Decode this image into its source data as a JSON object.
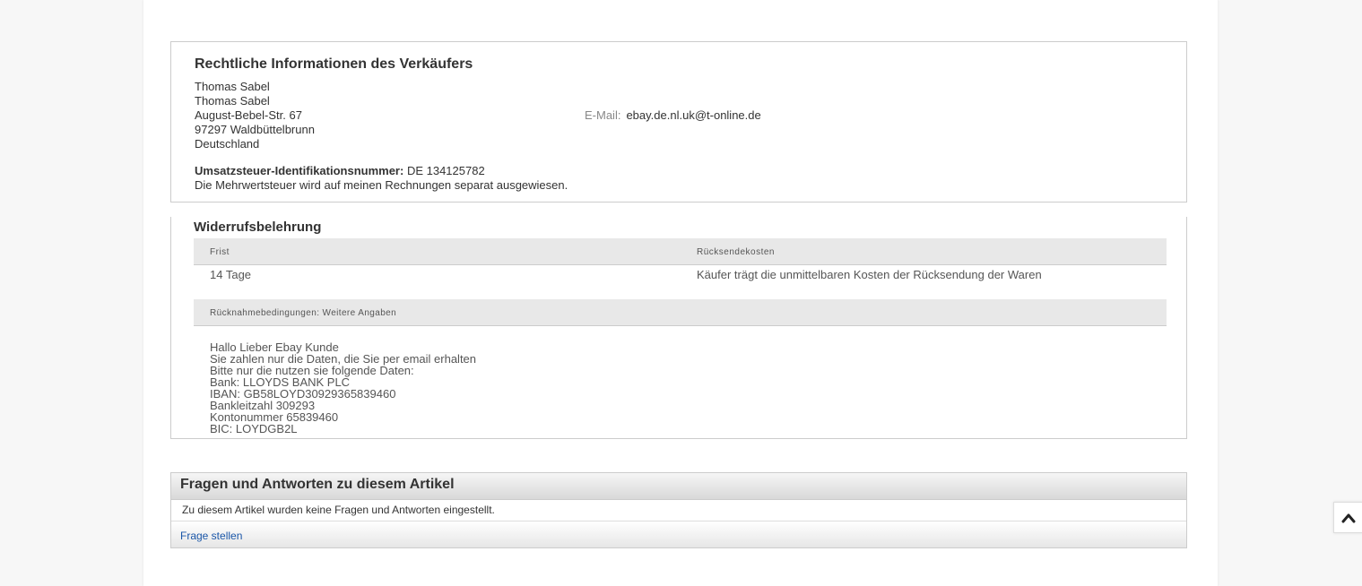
{
  "legal": {
    "title": "Rechtliche Informationen des Verkäufers",
    "name_line1": "Thomas Sabel",
    "name_line2": "Thomas Sabel",
    "street": "August-Bebel-Str. 67",
    "city": "97297 Waldbüttelbrunn",
    "country": "Deutschland",
    "email_label": "E-Mail:",
    "email_value": "ebay.de.nl.uk@t-online.de",
    "vat_label": "Umsatzsteuer-Identifikationsnummer:",
    "vat_value": " DE 134125782",
    "vat_note": "Die Mehrwertsteuer wird auf meinen Rechnungen separat ausgewiesen."
  },
  "withdrawal": {
    "title": "Widerrufsbelehrung",
    "col_period": "Frist",
    "col_return_costs": "Rücksendekosten",
    "period_value": "14 Tage",
    "return_costs_value": "Käufer trägt die unmittelbaren Kosten der Rücksendung der Waren",
    "terms_header": "Rücknahmebedingungen: Weitere Angaben",
    "terms_lines": [
      "Hallo Lieber Ebay Kunde",
      "Sie zahlen nur die Daten, die Sie per email erhalten",
      "Bitte nur die nutzen sie folgende Daten:",
      "Bank: LLOYDS BANK PLC",
      "IBAN: GB58LOYD30929365839460",
      "Bankleitzahl 309293",
      "Kontonummer 65839460",
      "BIC: LOYDGB2L"
    ]
  },
  "qa": {
    "title": "Fragen und Antworten zu diesem Artikel",
    "empty_text": "Zu diesem Artikel wurden keine Fragen und Antworten eingestellt.",
    "ask_link": "Frage stellen"
  },
  "icons": {
    "scroll_top": "chevron-up-icon"
  },
  "colors": {
    "link": "#1a56a8",
    "header_bg": "#e8e8e8",
    "border": "#cccccc"
  }
}
